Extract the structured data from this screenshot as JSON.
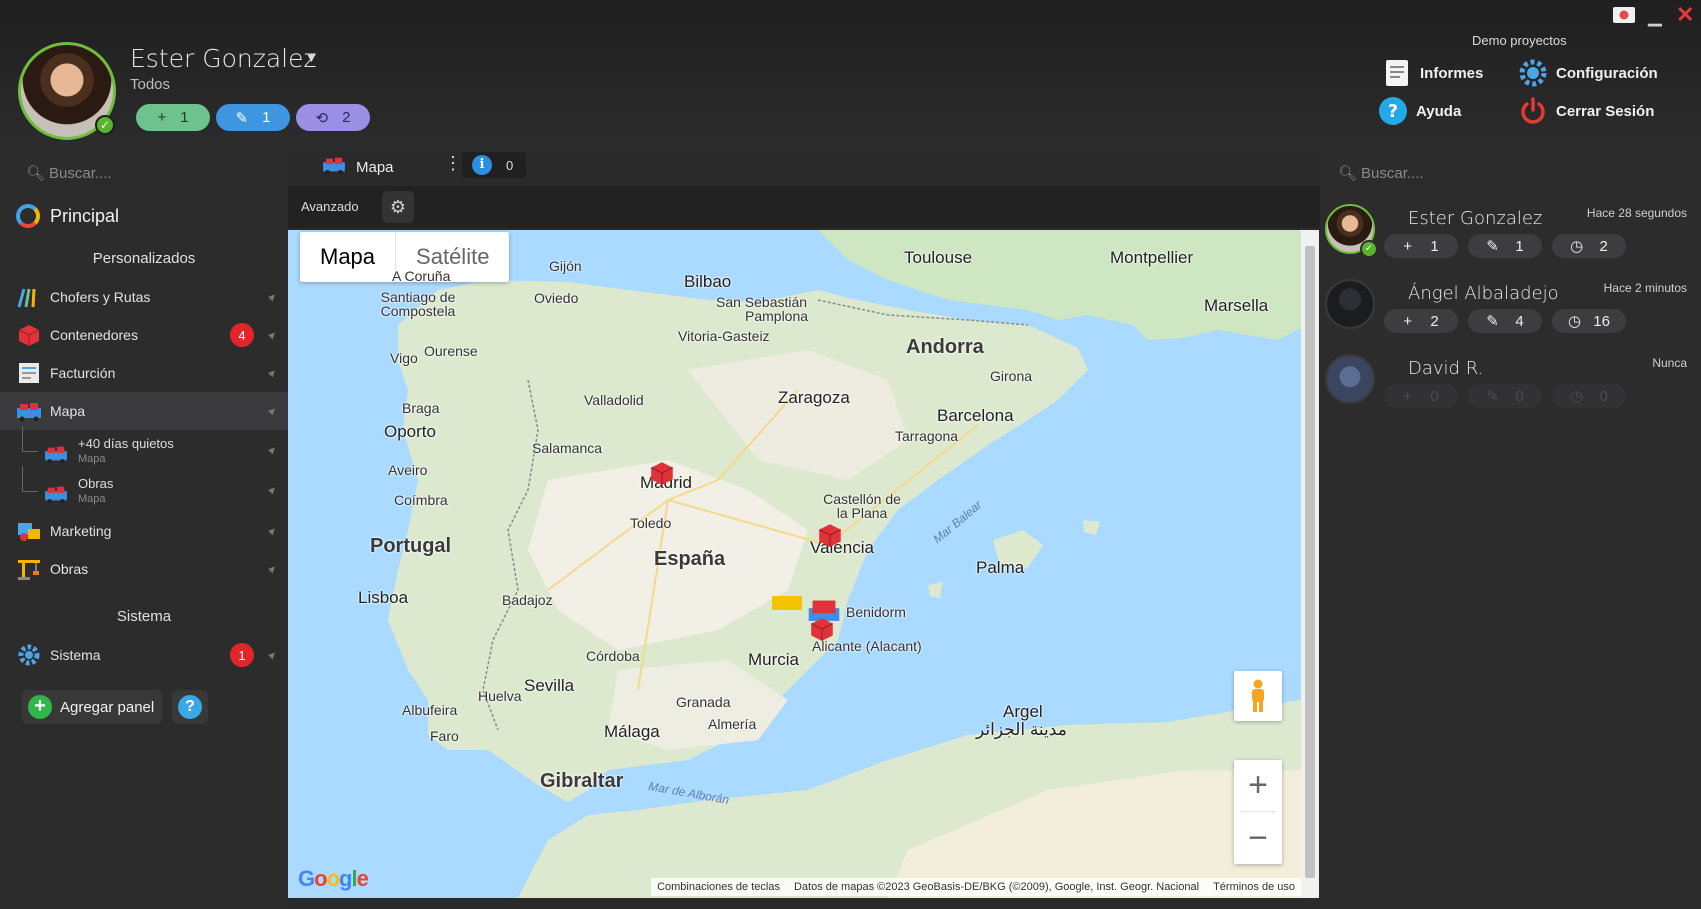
{
  "header": {
    "user_name": "Ester Gonzalez",
    "user_filter": "Todos",
    "counters": {
      "added": "1",
      "edited": "1",
      "history": "2"
    },
    "project": "Demo proyectos",
    "links": {
      "informes": "Informes",
      "configuracion": "Configuración",
      "ayuda": "Ayuda",
      "cerrar_sesion": "Cerrar Sesión"
    }
  },
  "sidebar": {
    "search_placeholder": "Buscar....",
    "principal": "Principal",
    "section_custom": "Personalizados",
    "items": [
      {
        "label": "Chofers y Rutas"
      },
      {
        "label": "Contenedores",
        "badge": "4"
      },
      {
        "label": "Facturción"
      },
      {
        "label": "Mapa"
      },
      {
        "label": "Marketing"
      },
      {
        "label": "Obras"
      }
    ],
    "subitems": [
      {
        "label": "+40 días quietos",
        "sub": "Mapa"
      },
      {
        "label": "Obras",
        "sub": "Mapa"
      }
    ],
    "section_system": "Sistema",
    "system_item": {
      "label": "Sistema",
      "badge": "1"
    },
    "add_panel": "Agregar panel"
  },
  "center": {
    "tab_label": "Mapa",
    "info_count": "0",
    "toolbar_label": "Avanzado"
  },
  "map": {
    "toggle_map": "Mapa",
    "toggle_satellite": "Satélite",
    "countries": [
      "Portugal",
      "España",
      "Andorra",
      "Gibraltar",
      "Argel",
      "مدينة الجزائر"
    ],
    "cities": [
      "A Coruña",
      "Gijón",
      "Bilbao",
      "Santiago de Compostela",
      "Oviedo",
      "San Sebastián",
      "Pamplona",
      "Vitoria-Gasteiz",
      "Toulouse",
      "Montpellier",
      "Marsella",
      "Vigo",
      "Ourense",
      "Braga",
      "Oporto",
      "Aveiro",
      "Coímbra",
      "Valladolid",
      "Salamanca",
      "Zaragoza",
      "Barcelona",
      "Girona",
      "Tarragona",
      "Madrid",
      "Toledo",
      "Castellón de la Plana",
      "Valencia",
      "Palma",
      "Lisboa",
      "Badajoz",
      "Benidorm",
      "Alicante (Alacant)",
      "Murcia",
      "Córdoba",
      "Sevilla",
      "Huelva",
      "Granada",
      "Almería",
      "Málaga",
      "Albufeira",
      "Faro"
    ],
    "seas": [
      "Mar Balear",
      "Mar de Alborán"
    ],
    "attribution": {
      "shortcuts": "Combinaciones de teclas",
      "data": "Datos de mapas ©2023 GeoBasis-DE/BKG (©2009), Google, Inst. Geogr. Nacional",
      "terms": "Términos de uso"
    },
    "logo": "Google"
  },
  "right": {
    "search_placeholder": "Buscar....",
    "users": [
      {
        "name": "Ester Gonzalez",
        "time": "Hace 28 segundos",
        "added": "1",
        "edited": "1",
        "history": "2"
      },
      {
        "name": "Ángel Albaladejo",
        "time": "Hace 2 minutos",
        "added": "2",
        "edited": "4",
        "history": "16"
      },
      {
        "name": "David R.",
        "time": "Nunca",
        "added": "0",
        "edited": "0",
        "history": "0"
      }
    ]
  }
}
